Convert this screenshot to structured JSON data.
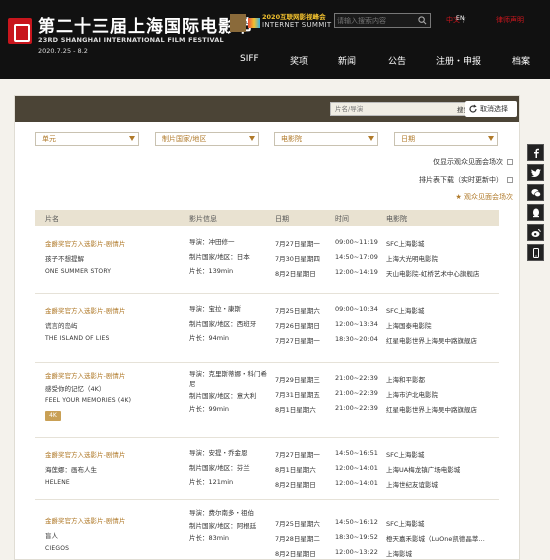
{
  "header": {
    "festival_title": "第二十三届上海国际电影节",
    "festival_subtitle": "23RD SHANGHAI INTERNATIONAL FILM FESTIVAL",
    "festival_date": "2020.7.25 - 8.2",
    "summit_cn": "2020互联网影视峰会",
    "summit_en": "INTERNET SUMMIT",
    "search_placeholder": "请输入搜索内容",
    "lang_zh": "中文",
    "lang_sep": "/",
    "lang_en": "EN",
    "lawyer_link": "律师声明",
    "nav": [
      "SIFF",
      "奖项",
      "新闻",
      "公告",
      "注册・申报",
      "档案"
    ],
    "active_nav": "公告"
  },
  "filters": {
    "keyword_placeholder": "片名/导演",
    "search_button": "搜索",
    "cancel_button": "取消选择",
    "selects": [
      "单元",
      "制片国家/地区",
      "电影院",
      "日期"
    ],
    "options": [
      "仅显示观众见面会场次",
      "排片表下载（实时更新中）"
    ],
    "favorite_link": "★ 观众见面会场次"
  },
  "table": {
    "headers": [
      "片名",
      "影片信息",
      "日期",
      "时间",
      "电影院"
    ],
    "rows": [
      {
        "category": "金爵奖官方入选影片-剧情片",
        "title_cn": "孩子不想提解",
        "title_en": "ONE SUMMER STORY",
        "badge": "",
        "info": [
          "导演：冲田修一",
          "制片国家/地区：日本",
          "片长：139min"
        ],
        "dates": [
          "7月27日星期一",
          "7月30日星期四",
          "8月2日星期日"
        ],
        "times": [
          "09:00~11:19",
          "14:50~17:09",
          "12:00~14:19"
        ],
        "cinemas": [
          "SFC上海影城",
          "上海大光明电影院",
          "天山电影院-虹桥艺术中心旗舰店"
        ]
      },
      {
        "category": "金爵奖官方入选影片-剧情片",
        "title_cn": "谎言的岛屿",
        "title_en": "THE ISLAND OF LIES",
        "badge": "",
        "info": [
          "导演：宝拉・康斯",
          "制片国家/地区：西班牙",
          "片长：94min"
        ],
        "dates": [
          "7月25日星期六",
          "7月26日星期日",
          "7月27日星期一"
        ],
        "times": [
          "09:00~10:34",
          "12:00~13:34",
          "18:30~20:04"
        ],
        "cinemas": [
          "SFC上海影城",
          "上海国泰电影院",
          "红星电影世界上海吴中路旗舰店"
        ]
      },
      {
        "category": "金爵奖官方入选影片-剧情片",
        "title_cn": "感受你的记忆（4K）",
        "title_en": "FEEL YOUR MEMORIES (4K)",
        "badge": "4K",
        "info": [
          "导演：克里斯蒂娜・科门希尼",
          "制片国家/地区：意大利",
          "片长：99min"
        ],
        "dates": [
          "7月29日星期三",
          "7月31日星期五",
          "8月1日星期六"
        ],
        "times": [
          "21:00~22:39",
          "21:00~22:39",
          "21:00~22:39"
        ],
        "cinemas": [
          "上海和平影都",
          "上海市沪北电影院",
          "红星电影世界上海吴中路旗舰店"
        ]
      },
      {
        "category": "金爵奖官方入选影片-剧情片",
        "title_cn": "海莲娜：画布人生",
        "title_en": "HELENE",
        "badge": "",
        "info": [
          "导演：安提・乔金恩",
          "制片国家/地区：芬兰",
          "片长：121min"
        ],
        "dates": [
          "7月27日星期一",
          "8月1日星期六",
          "8月2日星期日"
        ],
        "times": [
          "14:50~16:51",
          "12:00~14:01",
          "12:00~14:01"
        ],
        "cinemas": [
          "SFC上海影城",
          "上海UA梅龙镇广场电影城",
          "上海世纪友谊影城"
        ]
      },
      {
        "category": "金爵奖官方入选影片-剧情片",
        "title_cn": "盲人",
        "title_en": "CIEGOS",
        "badge": "",
        "info": [
          "导演：费尔南多・祖伯",
          "制片国家/地区：阿根廷",
          "片长：83min"
        ],
        "dates": [
          "7月25日星期六",
          "7月28日星期二",
          "8月2日星期日"
        ],
        "times": [
          "14:50~16:12",
          "18:30~19:52",
          "12:00~13:22"
        ],
        "cinemas": [
          "SFC上海影城",
          "橙天嘉禾影城（LuOne凯德晶萃…",
          "上海影城"
        ]
      }
    ]
  },
  "share_icons": [
    "facebook-icon",
    "twitter-icon",
    "wechat-icon",
    "qq-icon",
    "weibo-icon",
    "mobile-icon"
  ]
}
